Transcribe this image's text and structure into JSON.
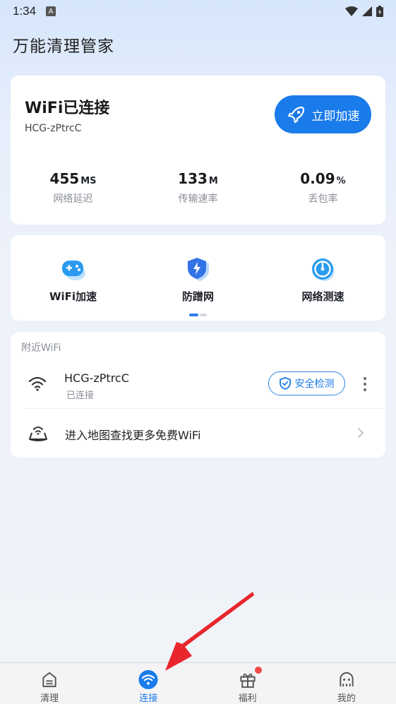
{
  "status_bar": {
    "time": "1:34",
    "a_icon": "A"
  },
  "app": {
    "title": "万能清理管家"
  },
  "wifi_card": {
    "status": "WiFi已连接",
    "ssid": "HCG-zPtrcC",
    "boost_label": "立即加速",
    "stats": [
      {
        "value": "455",
        "unit": "MS",
        "label": "网络延迟"
      },
      {
        "value": "133",
        "unit": "M",
        "label": "传输速率"
      },
      {
        "value": "0.09",
        "unit": "%",
        "label": "丢包率"
      }
    ]
  },
  "tools": [
    {
      "label": "WiFi加速",
      "icon": "gamepad-icon"
    },
    {
      "label": "防蹭网",
      "icon": "shield-bolt-icon"
    },
    {
      "label": "网络测速",
      "icon": "speedometer-icon"
    }
  ],
  "nearby": {
    "title": "附近WiFi",
    "network": {
      "name": "HCG-zPtrcC",
      "status": "已连接",
      "check_label": "安全检测"
    },
    "map_text": "进入地图查找更多免费WiFi"
  },
  "nav": [
    {
      "label": "清理",
      "icon": "clean-icon"
    },
    {
      "label": "连接",
      "icon": "wifi-icon",
      "active": true
    },
    {
      "label": "福利",
      "icon": "gift-icon"
    },
    {
      "label": "我的",
      "icon": "profile-icon"
    }
  ],
  "colors": {
    "accent": "#1a7bea",
    "annotation_arrow": "#e8262b",
    "badge": "#f04848"
  }
}
